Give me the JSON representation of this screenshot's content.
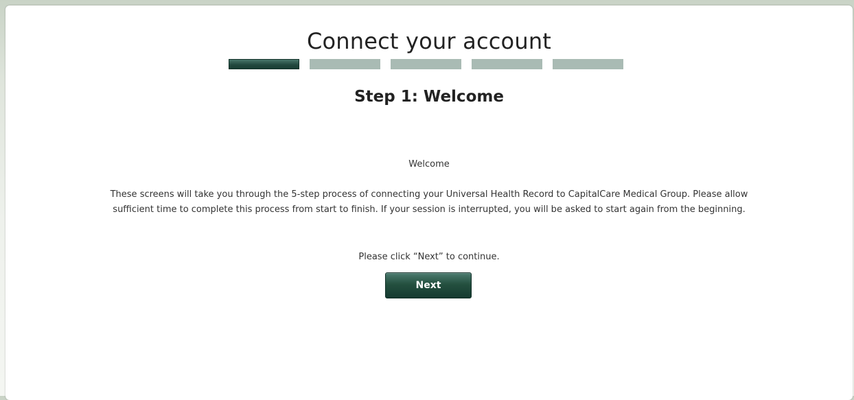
{
  "page": {
    "title": "Connect your account",
    "step_title": "Step 1: Welcome"
  },
  "progress": {
    "total_steps": 5,
    "current_step": 1,
    "active_color": "#1f463b",
    "inactive_color": "#a9bbb4"
  },
  "content": {
    "welcome_label": "Welcome",
    "intro_text": "These screens will take you through the 5-step process of connecting your Universal Health Record to CapitalCare Medical Group. Please allow sufficient time to complete this process from start to finish. If your session is interrupted, you will be asked to start again from the beginning.",
    "continue_prompt": "Please click “Next” to continue."
  },
  "actions": {
    "next_label": "Next"
  },
  "colors": {
    "accent": "#1f463b",
    "background": "#dfe5dc",
    "panel": "#ffffff"
  }
}
